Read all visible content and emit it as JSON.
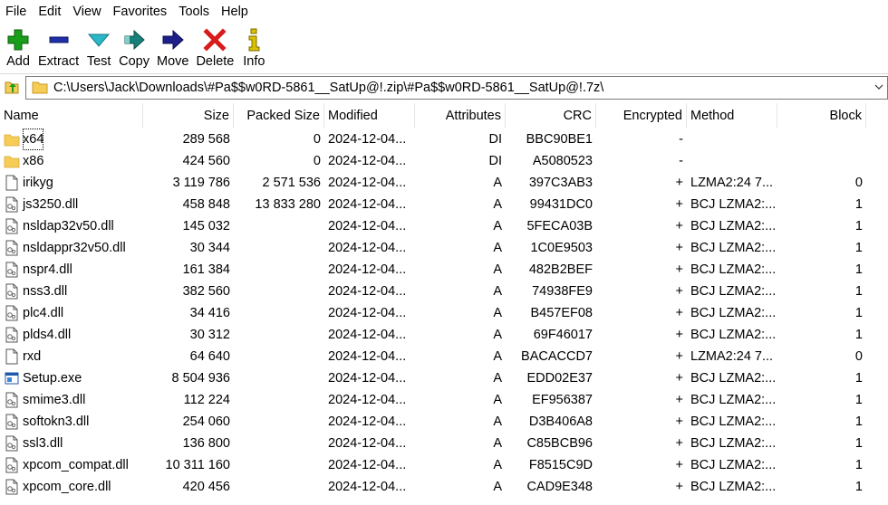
{
  "menu": [
    "File",
    "Edit",
    "View",
    "Favorites",
    "Tools",
    "Help"
  ],
  "toolbar": {
    "add": "Add",
    "extract": "Extract",
    "test": "Test",
    "copy": "Copy",
    "move": "Move",
    "delete": "Delete",
    "info": "Info"
  },
  "address": {
    "path": "C:\\Users\\Jack\\Downloads\\#Pa$$w0RD-5861__SatUp@!.zip\\#Pa$$w0RD-5861__SatUp@!.7z\\"
  },
  "columns": {
    "name": "Name",
    "size": "Size",
    "packed": "Packed Size",
    "modified": "Modified",
    "attributes": "Attributes",
    "crc": "CRC",
    "encrypted": "Encrypted",
    "method": "Method",
    "block": "Block"
  },
  "files": [
    {
      "name": "x64",
      "type": "folder",
      "size": "289 568",
      "packed": "0",
      "modified": "2024-12-04...",
      "attr": "DI",
      "crc": "BBC90BE1",
      "enc": "-",
      "method": "",
      "block": ""
    },
    {
      "name": "x86",
      "type": "folder",
      "size": "424 560",
      "packed": "0",
      "modified": "2024-12-04...",
      "attr": "DI",
      "crc": "A5080523",
      "enc": "-",
      "method": "",
      "block": ""
    },
    {
      "name": "irikyg",
      "type": "file",
      "size": "3 119 786",
      "packed": "2 571 536",
      "modified": "2024-12-04...",
      "attr": "A",
      "crc": "397C3AB3",
      "enc": "+",
      "method": "LZMA2:24 7...",
      "block": "0"
    },
    {
      "name": "js3250.dll",
      "type": "dll",
      "size": "458 848",
      "packed": "13 833 280",
      "modified": "2024-12-04...",
      "attr": "A",
      "crc": "99431DC0",
      "enc": "+",
      "method": "BCJ LZMA2:...",
      "block": "1"
    },
    {
      "name": "nsldap32v50.dll",
      "type": "dll",
      "size": "145 032",
      "packed": "",
      "modified": "2024-12-04...",
      "attr": "A",
      "crc": "5FECA03B",
      "enc": "+",
      "method": "BCJ LZMA2:...",
      "block": "1"
    },
    {
      "name": "nsldappr32v50.dll",
      "type": "dll",
      "size": "30 344",
      "packed": "",
      "modified": "2024-12-04...",
      "attr": "A",
      "crc": "1C0E9503",
      "enc": "+",
      "method": "BCJ LZMA2:...",
      "block": "1"
    },
    {
      "name": "nspr4.dll",
      "type": "dll",
      "size": "161 384",
      "packed": "",
      "modified": "2024-12-04...",
      "attr": "A",
      "crc": "482B2BEF",
      "enc": "+",
      "method": "BCJ LZMA2:...",
      "block": "1"
    },
    {
      "name": "nss3.dll",
      "type": "dll",
      "size": "382 560",
      "packed": "",
      "modified": "2024-12-04...",
      "attr": "A",
      "crc": "74938FE9",
      "enc": "+",
      "method": "BCJ LZMA2:...",
      "block": "1"
    },
    {
      "name": "plc4.dll",
      "type": "dll",
      "size": "34 416",
      "packed": "",
      "modified": "2024-12-04...",
      "attr": "A",
      "crc": "B457EF08",
      "enc": "+",
      "method": "BCJ LZMA2:...",
      "block": "1"
    },
    {
      "name": "plds4.dll",
      "type": "dll",
      "size": "30 312",
      "packed": "",
      "modified": "2024-12-04...",
      "attr": "A",
      "crc": "69F46017",
      "enc": "+",
      "method": "BCJ LZMA2:...",
      "block": "1"
    },
    {
      "name": "rxd",
      "type": "file",
      "size": "64 640",
      "packed": "",
      "modified": "2024-12-04...",
      "attr": "A",
      "crc": "BACACCD7",
      "enc": "+",
      "method": "LZMA2:24 7...",
      "block": "0"
    },
    {
      "name": "Setup.exe",
      "type": "exe",
      "size": "8 504 936",
      "packed": "",
      "modified": "2024-12-04...",
      "attr": "A",
      "crc": "EDD02E37",
      "enc": "+",
      "method": "BCJ LZMA2:...",
      "block": "1"
    },
    {
      "name": "smime3.dll",
      "type": "dll",
      "size": "112 224",
      "packed": "",
      "modified": "2024-12-04...",
      "attr": "A",
      "crc": "EF956387",
      "enc": "+",
      "method": "BCJ LZMA2:...",
      "block": "1"
    },
    {
      "name": "softokn3.dll",
      "type": "dll",
      "size": "254 060",
      "packed": "",
      "modified": "2024-12-04...",
      "attr": "A",
      "crc": "D3B406A8",
      "enc": "+",
      "method": "BCJ LZMA2:...",
      "block": "1"
    },
    {
      "name": "ssl3.dll",
      "type": "dll",
      "size": "136 800",
      "packed": "",
      "modified": "2024-12-04...",
      "attr": "A",
      "crc": "C85BCB96",
      "enc": "+",
      "method": "BCJ LZMA2:...",
      "block": "1"
    },
    {
      "name": "xpcom_compat.dll",
      "type": "dll",
      "size": "10 311 160",
      "packed": "",
      "modified": "2024-12-04...",
      "attr": "A",
      "crc": "F8515C9D",
      "enc": "+",
      "method": "BCJ LZMA2:...",
      "block": "1"
    },
    {
      "name": "xpcom_core.dll",
      "type": "dll",
      "size": "420 456",
      "packed": "",
      "modified": "2024-12-04...",
      "attr": "A",
      "crc": "CAD9E348",
      "enc": "+",
      "method": "BCJ LZMA2:...",
      "block": "1"
    }
  ],
  "colors": {
    "add": "#1a9d1a",
    "extract": "#1f2fa8",
    "test": "#2bb7c7",
    "copy": "#18807a",
    "move": "#1c1f8a",
    "delete": "#d81b1b",
    "info": "#d9c100",
    "folder": "#f6cc56"
  }
}
